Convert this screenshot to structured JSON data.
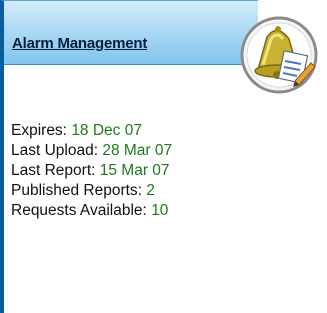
{
  "panel": {
    "title": "Alarm Management",
    "icon": "alarm-bell-report-icon",
    "colors": {
      "header_light": "#d4ecfa",
      "header_dark": "#82c5ee",
      "border": "#0b5c9e",
      "value_green": "#1e7a1e"
    }
  },
  "info": [
    {
      "label": "Expires:",
      "value": "18 Dec 07"
    },
    {
      "label": "Last Upload:",
      "value": "28 Mar 07"
    },
    {
      "label": "Last Report:",
      "value": "15 Mar 07"
    },
    {
      "label": "Published Reports:",
      "value": "2"
    },
    {
      "label": "Requests Available:",
      "value": "10"
    }
  ]
}
